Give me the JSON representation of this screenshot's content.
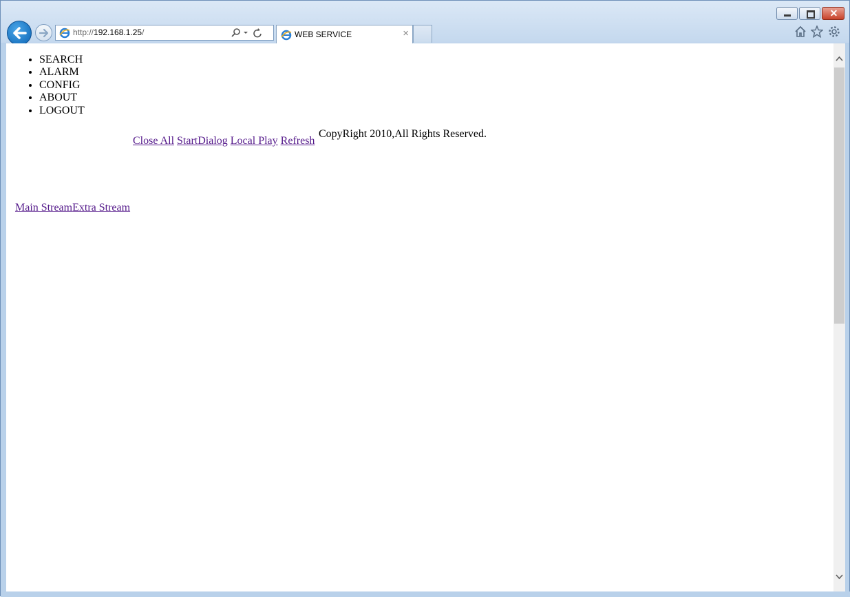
{
  "browser": {
    "address": {
      "scheme": "http://",
      "host": "192.168.1.25",
      "path": "/"
    },
    "tab": {
      "title": "WEB SERVICE",
      "close_glyph": "×"
    },
    "caption": {
      "close_glyph": "✕"
    },
    "icons": [
      "back-icon",
      "forward-icon",
      "ie-icon",
      "search-icon",
      "refresh-icon",
      "home-icon",
      "favorites-icon",
      "settings-icon"
    ]
  },
  "page": {
    "menu": [
      "SEARCH",
      "ALARM",
      "CONFIG",
      "ABOUT",
      "LOGOUT"
    ],
    "links": [
      "Close All",
      "StartDialog",
      "Local Play",
      "Refresh"
    ],
    "copyright": "CopyRight 2010,All Rights Reserved.",
    "streams": [
      "Main Stream",
      "Extra Stream"
    ]
  },
  "colors": {
    "link_visited": "#551a8b",
    "frame": "#b9d1ea"
  }
}
